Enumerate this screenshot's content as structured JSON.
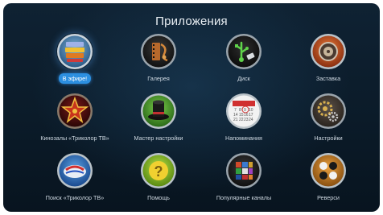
{
  "screen": {
    "title": "Приложения"
  },
  "apps": [
    {
      "label": "В эфире!",
      "icon": "on-air-tv-icon",
      "selected": true
    },
    {
      "label": "Галерея",
      "icon": "gallery-film-icon",
      "selected": false
    },
    {
      "label": "Диск",
      "icon": "usb-disk-icon",
      "selected": false
    },
    {
      "label": "Заставка",
      "icon": "screensaver-icon",
      "selected": false
    },
    {
      "label": "Кинозалы «Триколор ТВ»",
      "icon": "cinema-star-icon",
      "selected": false
    },
    {
      "label": "Мастер настройки",
      "icon": "setup-wizard-hat-icon",
      "selected": false
    },
    {
      "label": "Напоминания",
      "icon": "calendar-reminder-icon",
      "selected": false
    },
    {
      "label": "Настройки",
      "icon": "settings-gears-icon",
      "selected": false
    },
    {
      "label": "Поиск «Триколор ТВ»",
      "icon": "tricolor-search-icon",
      "selected": false
    },
    {
      "label": "Помощь",
      "icon": "help-question-icon",
      "selected": false
    },
    {
      "label": "Популярные каналы",
      "icon": "popular-channels-cube-icon",
      "selected": false
    },
    {
      "label": "Реверси",
      "icon": "reversi-game-icon",
      "selected": false
    }
  ]
}
